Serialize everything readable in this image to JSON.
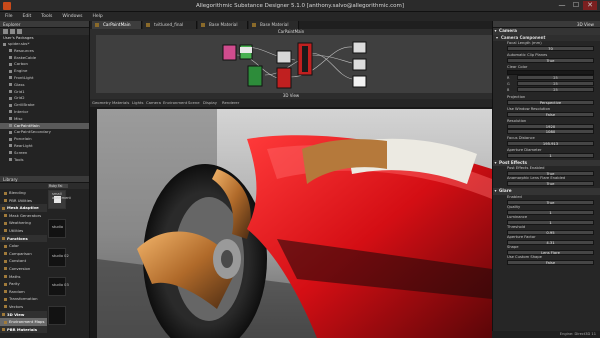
{
  "window": {
    "title": "Allegorithmic Substance Designer 5.1.0 [anthony.salvo@allegorithmic.com]",
    "min": "—",
    "max": "☐",
    "close": "✕"
  },
  "menubar": [
    "File",
    "Edit",
    "Tools",
    "Windows",
    "Help"
  ],
  "explorer": {
    "title": "Explorer",
    "user_pkg": "User's Packages",
    "items": [
      {
        "label": "spider.sbs*",
        "level": 0
      },
      {
        "label": "Resources",
        "level": 1
      },
      {
        "label": "BrakeCable",
        "level": 1
      },
      {
        "label": "Carbon",
        "level": 1
      },
      {
        "label": "Engine",
        "level": 1
      },
      {
        "label": "FrontLight",
        "level": 1
      },
      {
        "label": "Glass",
        "level": 1
      },
      {
        "label": "Grid1",
        "level": 1
      },
      {
        "label": "Grid2",
        "level": 1
      },
      {
        "label": "GrrillBrake",
        "level": 1
      },
      {
        "label": "Interior",
        "level": 1
      },
      {
        "label": "Misc",
        "level": 1
      },
      {
        "label": "CarPaintMain",
        "level": 1,
        "selected": true
      },
      {
        "label": "CarPaintSecondary",
        "level": 1
      },
      {
        "label": "Porcelain",
        "level": 1
      },
      {
        "label": "RearLight",
        "level": 1
      },
      {
        "label": "Screen",
        "level": 1
      },
      {
        "label": "Tools",
        "level": 1
      }
    ]
  },
  "library": {
    "title": "Library",
    "search_tag": "Ruby Fai",
    "categories": [
      {
        "label": "Blending",
        "hdr": false
      },
      {
        "label": "PBR Utilities",
        "hdr": false
      },
      {
        "label": "Mesh Adaptive",
        "hdr": true
      },
      {
        "label": "Mask Generators",
        "hdr": false
      },
      {
        "label": "Weathering",
        "hdr": false
      },
      {
        "label": "Utilities",
        "hdr": false
      },
      {
        "label": "Functions",
        "hdr": true
      },
      {
        "label": "Color",
        "hdr": false
      },
      {
        "label": "Comparison",
        "hdr": false
      },
      {
        "label": "Constant",
        "hdr": false
      },
      {
        "label": "Conversion",
        "hdr": false
      },
      {
        "label": "Maths",
        "hdr": false
      },
      {
        "label": "Parity",
        "hdr": false
      },
      {
        "label": "Random",
        "hdr": false
      },
      {
        "label": "Transformation",
        "hdr": false
      },
      {
        "label": "Vectors",
        "hdr": false
      },
      {
        "label": "3D View",
        "hdr": true
      },
      {
        "label": "Environment Maps",
        "hdr": false,
        "selected": true
      },
      {
        "label": "PBR Materials",
        "hdr": true
      }
    ],
    "thumbs": [
      "small apartment",
      "studio",
      "studio 02",
      "studio 03",
      ""
    ]
  },
  "tabs": [
    {
      "label": "CarPaintMain",
      "active": true
    },
    {
      "label": "tvitlused_final",
      "active": false
    },
    {
      "label": "Base Material",
      "active": false
    },
    {
      "label": "Base Material",
      "active": false
    }
  ],
  "graph": {
    "title": "CarPaintMain"
  },
  "view3d": {
    "title": "3D View",
    "toolbar": [
      "Geometry",
      "Materials",
      "Lights",
      "Camera",
      "Environment",
      "Scene",
      "Display",
      "Renderer"
    ]
  },
  "properties": {
    "title": "3D View",
    "camera": {
      "section": "Camera",
      "component": "Camera Component",
      "focal_label": "Focal Length (mm)",
      "focal_value": "70",
      "auto_clip_label": "Automatic Clip Planes",
      "auto_clip_value": "True",
      "clear_color_label": "Clear Color",
      "rgb": {
        "r_label": "R",
        "r_value": "25",
        "g_label": "G",
        "g_value": "25",
        "b_label": "B",
        "b_value": "25"
      },
      "projection_label": "Projection",
      "projection_value": "Perspective",
      "window_res_label": "Use Window Resolution",
      "window_res_value": "False",
      "resolution_label": "Resolution",
      "res_w": "1920",
      "res_h": "1080",
      "focus_label": "Focus Distance",
      "focus_value": "195.913",
      "aperture_label": "Aperture Diameter",
      "aperture_value": "1"
    },
    "post": {
      "section": "Post Effects",
      "enabled_label": "Post Effects Enabled",
      "enabled_value": "True",
      "lens_label": "Anamorphic Lens Flare Enabled",
      "lens_value": "True"
    },
    "glare": {
      "section": "Glare",
      "enabled_label": "Enabled",
      "enabled_value": "True",
      "quality_label": "Quality",
      "quality_value": "1",
      "luminance_label": "Luminance",
      "luminance_value": "1",
      "threshold_label": "Threshold",
      "threshold_value": "0.95",
      "aperture_label": "Aperture Factor",
      "aperture_value": "4.31",
      "shape_label": "Shape",
      "shape_value": "Lens Flare",
      "custom_label": "Use Custom Shape",
      "custom_value": "False"
    }
  },
  "status": "Engine: Direct3D 11"
}
